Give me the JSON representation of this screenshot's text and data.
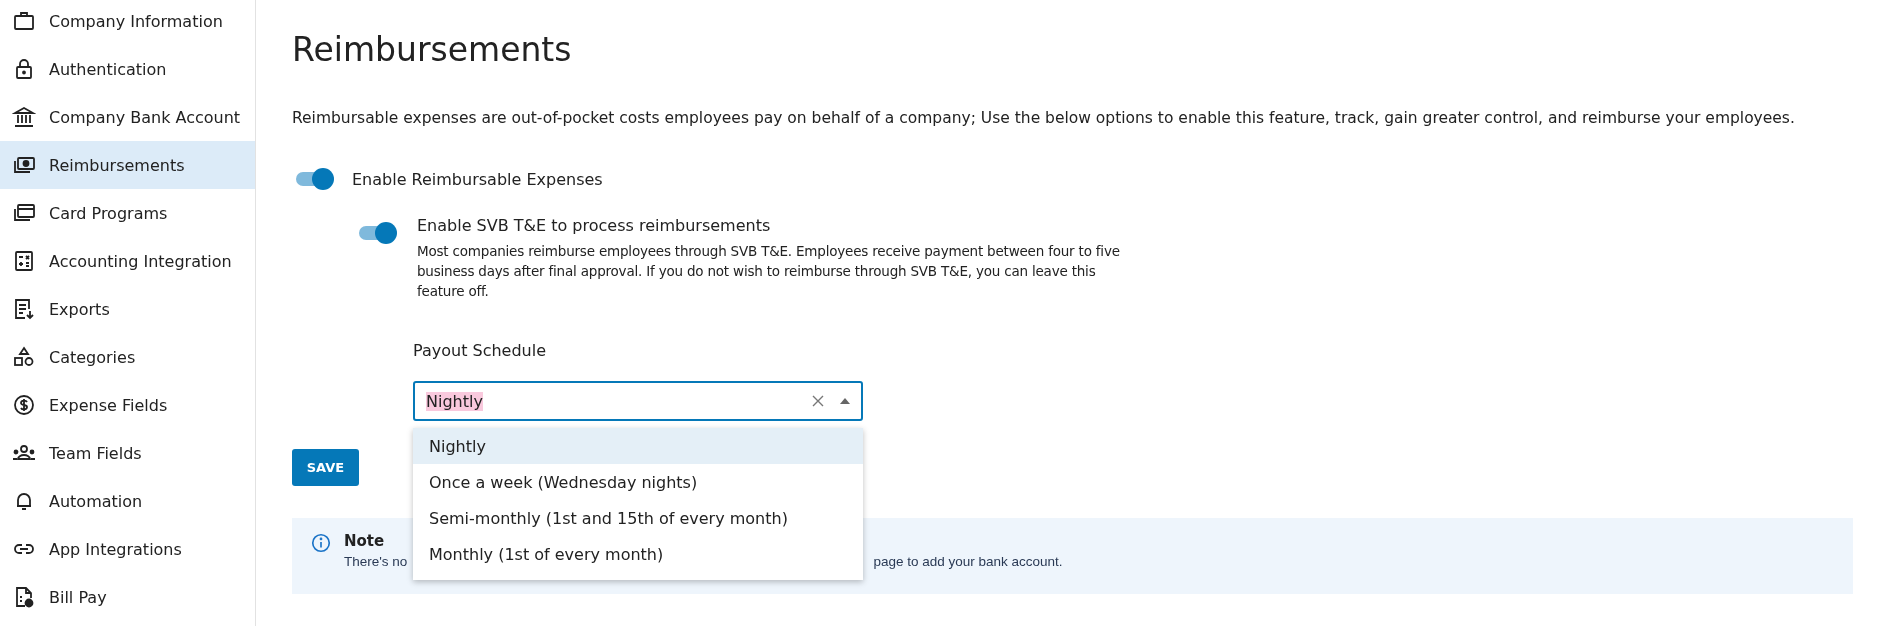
{
  "sidebar": {
    "items": [
      {
        "label": "Company Information",
        "selected": false
      },
      {
        "label": "Authentication",
        "selected": false
      },
      {
        "label": "Company Bank Account",
        "selected": false
      },
      {
        "label": "Reimbursements",
        "selected": true
      },
      {
        "label": "Card Programs",
        "selected": false
      },
      {
        "label": "Accounting Integration",
        "selected": false
      },
      {
        "label": "Exports",
        "selected": false
      },
      {
        "label": "Categories",
        "selected": false
      },
      {
        "label": "Expense Fields",
        "selected": false
      },
      {
        "label": "Team Fields",
        "selected": false
      },
      {
        "label": "Automation",
        "selected": false
      },
      {
        "label": "App Integrations",
        "selected": false
      },
      {
        "label": "Bill Pay",
        "selected": false
      }
    ]
  },
  "page": {
    "title": "Reimbursements",
    "description": "Reimbursable expenses are out-of-pocket costs employees pay on behalf of a company; Use the below options to enable this feature, track, gain greater control, and reimburse your employees.",
    "toggle_reimbursable": {
      "label": "Enable Reimbursable Expenses",
      "on": true
    },
    "toggle_svb": {
      "label": "Enable SVB T&E to process reimbursements",
      "on": true,
      "help": "Most companies reimburse employees through SVB T&E. Employees receive payment between four to five business days after final approval. If you do not wish to reimburse through SVB T&E, you can leave this feature off."
    },
    "payout_schedule": {
      "label": "Payout Schedule",
      "value": "Nightly",
      "expanded": true,
      "options": [
        {
          "label": "Nightly",
          "selected": true
        },
        {
          "label": "Once a week (Wednesday nights)",
          "selected": false
        },
        {
          "label": "Semi-monthly (1st and 15th of every month)",
          "selected": false
        },
        {
          "label": "Monthly (1st of every month)",
          "selected": false
        }
      ]
    },
    "save_button": "SAVE",
    "note": {
      "title": "Note",
      "text_start": "There's no",
      "text_end": "page to add your bank account."
    }
  }
}
